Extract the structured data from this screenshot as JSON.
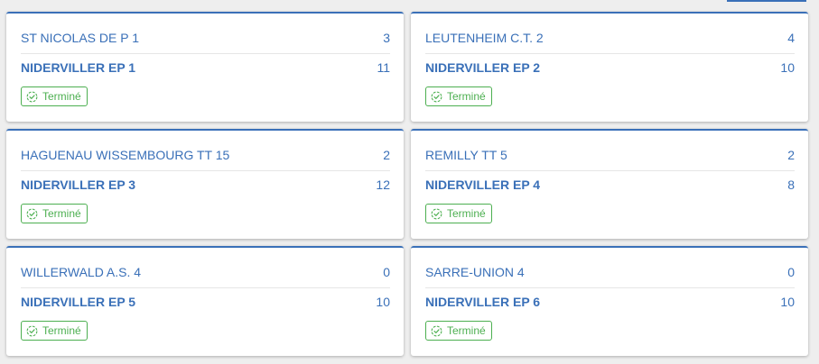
{
  "matches": [
    {
      "home_team": "ST NICOLAS DE P 1",
      "home_score": "3",
      "away_team": "NIDERVILLER EP 1",
      "away_score": "11",
      "status": "Terminé"
    },
    {
      "home_team": "LEUTENHEIM C.T. 2",
      "home_score": "4",
      "away_team": "NIDERVILLER EP 2",
      "away_score": "10",
      "status": "Terminé"
    },
    {
      "home_team": "HAGUENAU WISSEMBOURG TT 15",
      "home_score": "2",
      "away_team": "NIDERVILLER EP 3",
      "away_score": "12",
      "status": "Terminé"
    },
    {
      "home_team": "REMILLY TT 5",
      "home_score": "2",
      "away_team": "NIDERVILLER EP 4",
      "away_score": "8",
      "status": "Terminé"
    },
    {
      "home_team": "WILLERWALD A.S. 4",
      "home_score": "0",
      "away_team": "NIDERVILLER EP 5",
      "away_score": "10",
      "status": "Terminé"
    },
    {
      "home_team": "SARRE-UNION 4",
      "home_score": "0",
      "away_team": "NIDERVILLER EP 6",
      "away_score": "10",
      "status": "Terminé"
    }
  ],
  "colors": {
    "accent": "#3a70b8",
    "status_done": "#4caf50",
    "background": "#eeeeee"
  },
  "icons": {
    "status_icon": "check-circle-dashed-icon"
  }
}
